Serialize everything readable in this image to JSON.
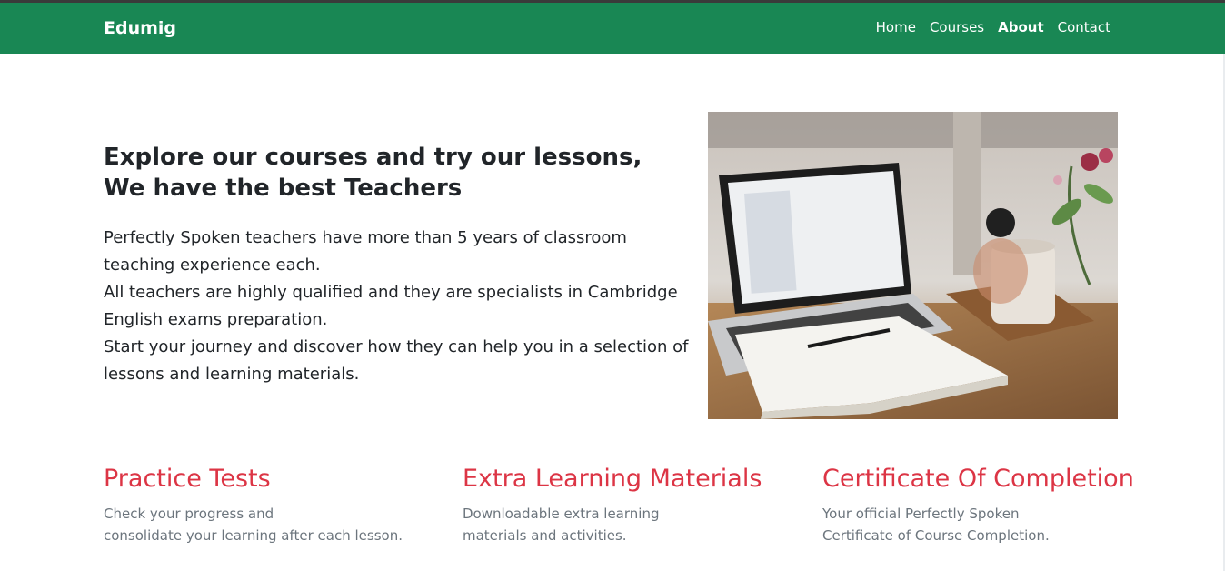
{
  "navbar": {
    "brand": "Edumig",
    "links": [
      {
        "label": "Home",
        "active": false
      },
      {
        "label": "Courses",
        "active": false
      },
      {
        "label": "About",
        "active": true
      },
      {
        "label": "Contact",
        "active": false
      }
    ]
  },
  "hero": {
    "title_line1": "Explore our courses and try our lessons,",
    "title_line2": "We have the best Teachers",
    "paragraphs": [
      "Perfectly Spoken teachers have more than 5 years of classroom teaching experience each.",
      "All teachers are highly qualified and they are specialists in Cambridge English exams preparation.",
      "Start your journey and discover how they can help you in a selection of lessons and learning materials."
    ],
    "image_icon": "laptop-notebook-desk-photo"
  },
  "features": [
    {
      "title": "Practice Tests",
      "line1": "Check your progress and",
      "line2": "consolidate your learning after each lesson."
    },
    {
      "title": "Extra Learning Materials",
      "line1": "Downloadable extra learning",
      "line2": "materials and activities."
    },
    {
      "title": "Certificate Of Completion",
      "line1": "Your official Perfectly Spoken",
      "line2": "Certificate of Course Completion."
    }
  ],
  "colors": {
    "navbar": "#198754",
    "feature_title": "#dc3545",
    "muted_text": "#6c757d"
  }
}
